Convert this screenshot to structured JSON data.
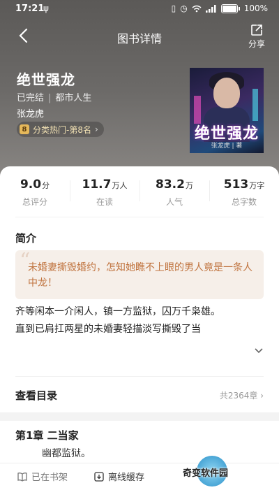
{
  "statusbar": {
    "time": "17:21",
    "notif_icon": "usb-icon",
    "battery_label": "100%"
  },
  "header": {
    "title": "图书详情",
    "share_label": "分享"
  },
  "book": {
    "title": "绝世强龙",
    "status": "已完结",
    "genre": "都市人生",
    "author": "张龙虎",
    "rank_badge": "8",
    "rank_text": "分类热门-第8名",
    "cover_title": "绝世强龙",
    "cover_author": "张龙虎 | 著"
  },
  "stats": [
    {
      "value": "9.0",
      "unit": "分",
      "label": "总评分"
    },
    {
      "value": "11.7",
      "unit": "万人",
      "label": "在读"
    },
    {
      "value": "83.2",
      "unit": "万",
      "label": "人气"
    },
    {
      "value": "513",
      "unit": "万字",
      "label": "总字数"
    }
  ],
  "intro": {
    "heading": "简介",
    "quote": "未婚妻撕毁婚约，怎知她瞧不上眼的男人竟是一条人中龙！",
    "para1": "齐等闲本一介闲人，镇一方监狱，囚万千枭雄。",
    "para2": "直到已肩扛两星的未婚妻轻描淡写撕毁了当"
  },
  "catalog": {
    "label": "查看目录",
    "count": "共2364章"
  },
  "chapter": {
    "title": "第1章 二当家",
    "first_line": "幽都监狱。"
  },
  "bottom": {
    "shelf_label": "已在书架",
    "offline_label": "离线缓存",
    "watermark": "奇变软件园"
  },
  "colors": {
    "accent": "#c0733e",
    "quote_bg": "#f6efe9",
    "rank_badge": "#e5b85a"
  }
}
